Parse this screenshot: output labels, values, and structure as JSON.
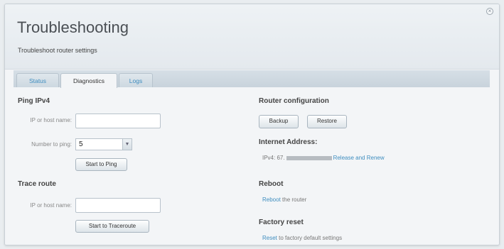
{
  "header": {
    "title": "Troubleshooting",
    "subtitle": "Troubleshoot router settings"
  },
  "tabs": [
    {
      "label": "Status",
      "active": false
    },
    {
      "label": "Diagnostics",
      "active": true
    },
    {
      "label": "Logs",
      "active": false
    }
  ],
  "ping": {
    "section_title": "Ping IPv4",
    "host_label": "IP or host name:",
    "host_value": "",
    "count_label": "Number to ping:",
    "count_value": "5",
    "start_button": "Start to Ping"
  },
  "trace": {
    "section_title": "Trace route",
    "host_label": "IP or host name:",
    "host_value": "",
    "start_button": "Start to Traceroute"
  },
  "router_config": {
    "section_title": "Router configuration",
    "backup_button": "Backup",
    "restore_button": "Restore"
  },
  "internet_address": {
    "section_title": "Internet Address:",
    "ipv4_prefix": "IPv4: 67.",
    "release_renew_link": "Release and Renew"
  },
  "reboot": {
    "section_title": "Reboot",
    "link": "Reboot",
    "text": "the router"
  },
  "factory_reset": {
    "section_title": "Factory reset",
    "link": "Reset",
    "text": "to factory default settings"
  },
  "colors": {
    "link": "#3e8dbf",
    "tab_active": "#f3f5f7"
  }
}
